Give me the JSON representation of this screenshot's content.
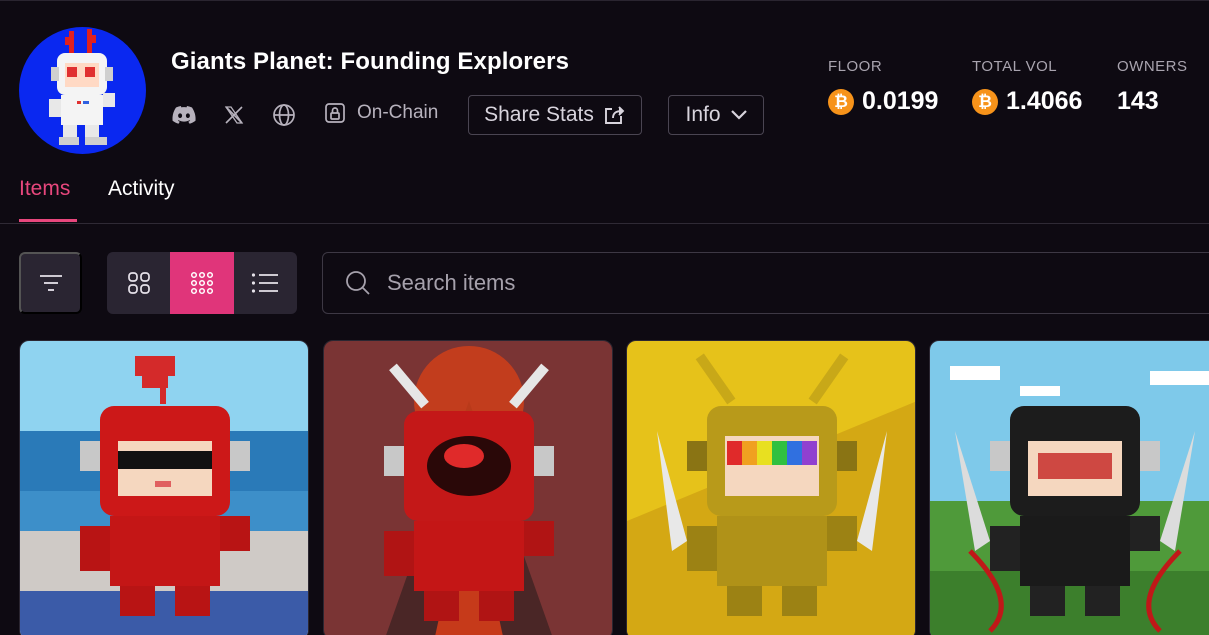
{
  "collection": {
    "title": "Giants Planet: Founding Explorers",
    "onchain_label": "On-Chain",
    "share_label": "Share Stats",
    "info_label": "Info"
  },
  "social_icons": [
    "discord-icon",
    "x-icon",
    "globe-icon"
  ],
  "stats": [
    {
      "label": "FLOOR",
      "value": "0.0199",
      "currency_icon": "bitcoin-icon"
    },
    {
      "label": "TOTAL VOL",
      "value": "1.4066",
      "currency_icon": "bitcoin-icon"
    },
    {
      "label": "OWNERS",
      "value": "143"
    }
  ],
  "tabs": [
    {
      "label": "Items",
      "active": true
    },
    {
      "label": "Activity",
      "active": false
    }
  ],
  "toolbar": {
    "filter_icon": "filter-icon",
    "views": [
      "large-grid-icon",
      "small-grid-icon",
      "list-icon"
    ],
    "active_view": "small-grid-icon",
    "search_placeholder": "Search items",
    "search_value": ""
  },
  "colors": {
    "background": "#0e0a12",
    "accent": "#e0357a",
    "bitcoin": "#f7931a"
  },
  "items": [
    {
      "name": "red-explorer-heart-beach",
      "bg": "#8fd3f0",
      "suit": "#cc1818"
    },
    {
      "name": "red-explorer-volcano",
      "bg": "#7a2a2a",
      "suit": "#c41818"
    },
    {
      "name": "gold-explorer-rainbow-visor",
      "bg": "#e6c21a",
      "suit": "#b89a1a"
    },
    {
      "name": "black-explorer-meadow",
      "bg": "#7ec9ea",
      "suit": "#1c1c1c"
    }
  ]
}
